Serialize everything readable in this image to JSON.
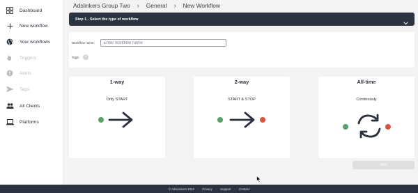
{
  "sidebar": {
    "items": [
      {
        "label": "Dashboard",
        "icon": "grid-icon",
        "disabled": false
      },
      {
        "label": "New workflow",
        "icon": "plus-icon",
        "disabled": false
      },
      {
        "label": "Your workflows",
        "icon": "globe-icon",
        "disabled": false
      },
      {
        "label": "Triggers",
        "icon": "hand-icon",
        "disabled": true
      },
      {
        "label": "Alerts",
        "icon": "alert-icon",
        "disabled": true
      },
      {
        "label": "Tags",
        "icon": "send-icon",
        "disabled": true
      },
      {
        "label": "All Clients",
        "icon": "users-icon",
        "disabled": false
      },
      {
        "label": "Platforms",
        "icon": "laptop-icon",
        "disabled": false
      }
    ]
  },
  "breadcrumb": [
    "Adslinkers Group Two",
    "General",
    "New Workflow"
  ],
  "step": {
    "label": "Step 1 - Select the type of workflow"
  },
  "form": {
    "name_label": "Workflow name:",
    "name_placeholder": "Enter workflow name",
    "name_value": "",
    "tags_label": "Tags:",
    "tag_add": "+"
  },
  "cards": [
    {
      "title": "1-way",
      "subtitle": "Only START",
      "icon": "arrow-right-icon"
    },
    {
      "title": "2-way",
      "subtitle": "START & STOP",
      "icon": "arrow-right-icon"
    },
    {
      "title": "All-time",
      "subtitle": "Continously",
      "icon": "refresh-icon"
    }
  ],
  "next_button": "Next",
  "footer": {
    "copyright": "© AdsLinkers 2024",
    "links": [
      "Privacy",
      "Support",
      "Contact"
    ]
  },
  "colors": {
    "dark_navy": "#2d3441",
    "start_green": "#5aa06a",
    "stop_red": "#d9533f",
    "disabled_button": "#dedfe1"
  }
}
